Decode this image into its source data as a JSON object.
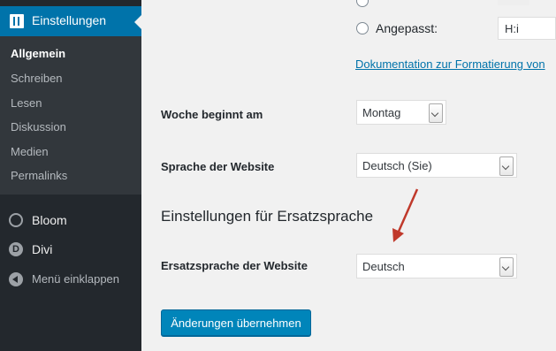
{
  "sidebar": {
    "active_menu": "Einstellungen",
    "submenu": [
      "Allgemein",
      "Schreiben",
      "Lesen",
      "Diskussion",
      "Medien",
      "Permalinks"
    ],
    "items": [
      {
        "label": "Bloom",
        "icon": "bloom-icon"
      },
      {
        "label": "Divi",
        "icon": "divi-icon",
        "icon_letter": "D"
      },
      {
        "label": "Menü einklappen",
        "icon": "collapse-icon"
      }
    ]
  },
  "time_format": {
    "custom_label": "Angepasst:",
    "custom_value": "H:i",
    "docs_link": "Dokumentation zur Formatierung von"
  },
  "week_starts": {
    "label": "Woche beginnt am",
    "value": "Montag"
  },
  "site_language": {
    "label": "Sprache der Website",
    "value": "Deutsch (Sie)"
  },
  "fallback_section": {
    "heading": "Einstellungen für Ersatzsprache",
    "label": "Ersatzsprache der Website",
    "value": "Deutsch"
  },
  "submit_label": "Änderungen übernehmen",
  "colors": {
    "sidebar": "#23282d",
    "submenu": "#32373c",
    "accent": "#0073aa",
    "button": "#0085ba",
    "arrow": "#c0392b"
  }
}
